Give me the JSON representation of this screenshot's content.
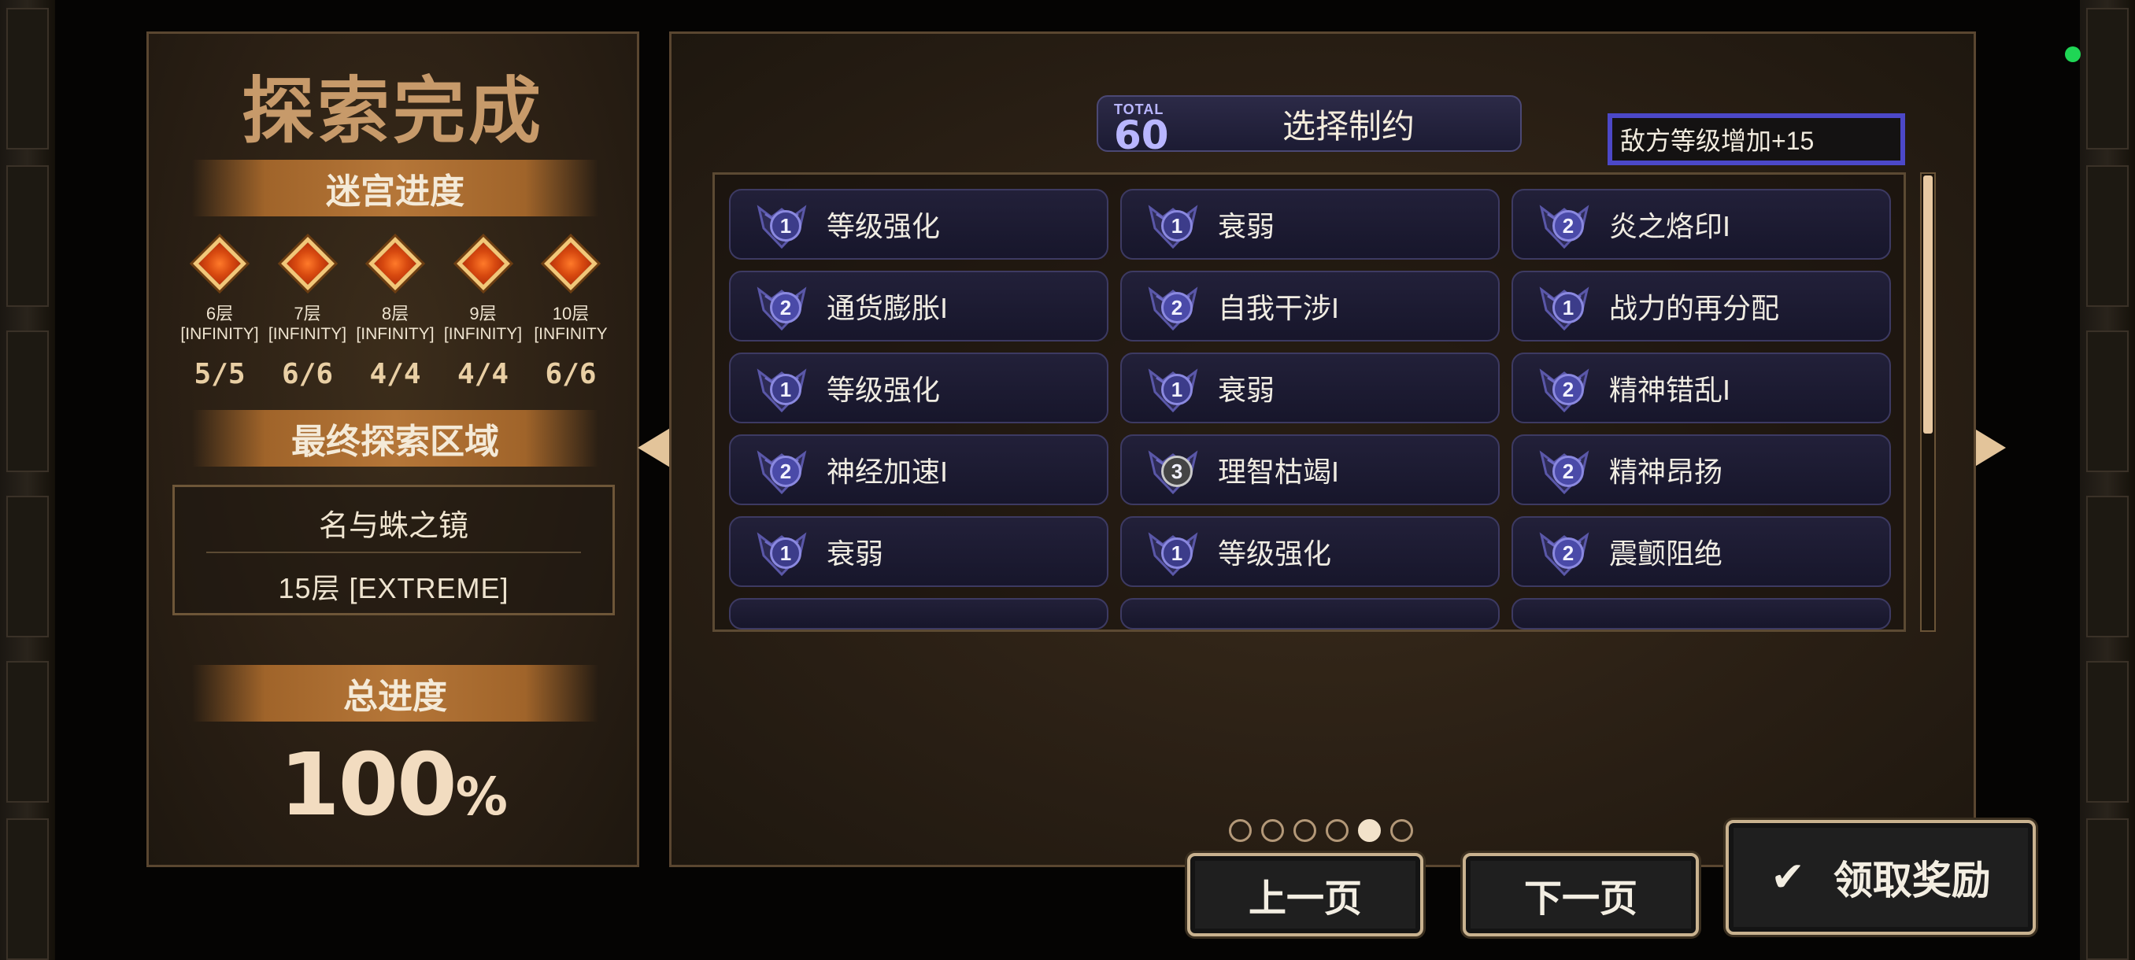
{
  "left_panel": {
    "title": "探索完成",
    "maze_progress_label": "迷宫进度",
    "floors": [
      {
        "name": "6层",
        "mode": "[INFINITY]",
        "count": "5/5"
      },
      {
        "name": "7层",
        "mode": "[INFINITY]",
        "count": "6/6"
      },
      {
        "name": "8层",
        "mode": "[INFINITY]",
        "count": "4/4"
      },
      {
        "name": "9层",
        "mode": "[INFINITY]",
        "count": "4/4"
      },
      {
        "name": "10层",
        "mode": "[INFINITY",
        "count": "6/6"
      }
    ],
    "final_area_label": "最终探索区域",
    "final_area_name": "名与蛛之镜",
    "final_area_floor": "15层 [EXTREME]",
    "total_progress_label": "总进度",
    "total_progress_value": "100",
    "total_progress_unit": "%"
  },
  "restrictions": {
    "total_label": "TOTAL",
    "total_value": "60",
    "title": "选择制约",
    "tip": "敌方等级增加+15",
    "items": [
      {
        "level": "1",
        "label": "等级强化"
      },
      {
        "level": "1",
        "label": "衰弱"
      },
      {
        "level": "2",
        "label": "炎之烙印I"
      },
      {
        "level": "2",
        "label": "通货膨胀I"
      },
      {
        "level": "2",
        "label": "自我干涉I"
      },
      {
        "level": "1",
        "label": "战力的再分配"
      },
      {
        "level": "1",
        "label": "等级强化"
      },
      {
        "level": "1",
        "label": "衰弱"
      },
      {
        "level": "2",
        "label": "精神错乱I"
      },
      {
        "level": "2",
        "label": "神经加速I"
      },
      {
        "level": "3",
        "label": "理智枯竭I"
      },
      {
        "level": "2",
        "label": "精神昂扬"
      },
      {
        "level": "1",
        "label": "衰弱"
      },
      {
        "level": "1",
        "label": "等级强化"
      },
      {
        "level": "2",
        "label": "震颤阻绝"
      }
    ],
    "pages": 6,
    "current_page": 5,
    "scroll_position": 0.0
  },
  "buttons": {
    "prev": "上一页",
    "next": "下一页",
    "claim": "领取奖励"
  },
  "colors": {
    "accent_gold": "#c79a6a",
    "card_bg": "#1d1c34",
    "highlight_border": "#4c48c8",
    "status_dot": "#1fd655"
  }
}
